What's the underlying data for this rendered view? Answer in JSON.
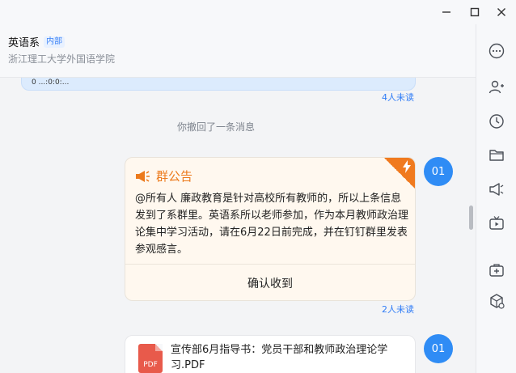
{
  "window": {
    "minimize_icon": "minimize-icon",
    "maximize_icon": "maximize-icon",
    "close_icon": "close-icon"
  },
  "header": {
    "title": "英语系",
    "tag": "内部",
    "subtitle": "浙江理工大学外国语学院"
  },
  "chat": {
    "prev_message_fragment": "0 ...:0:0:...",
    "prev_unread": "4人未读",
    "recall_notice": "你撤回了一条消息",
    "announcement": {
      "avatar_text": "01",
      "title": "群公告",
      "body": "@所有人 廉政教育是针对高校所有教师的，所以上条信息发到了系群里。英语系所以老师参加，作为本月教师政治理论集中学习活动，请在6月22日前完成，并在钉钉群里发表参观感言。",
      "action_label": "确认收到",
      "unread": "2人未读"
    },
    "file_message": {
      "avatar_text": "01",
      "file_type": "PDF",
      "file_name": "宣传部6月指导书：党员干部和教师政治理论学习.PDF"
    }
  },
  "sidebar": {
    "icons": [
      "more-icon",
      "add-member-icon",
      "history-icon",
      "folder-icon",
      "announcement-icon",
      "live-icon",
      "add-app-icon",
      "app-box-icon"
    ]
  },
  "colors": {
    "accent_blue": "#2f8cf5",
    "announcement_orange": "#ec7a1c",
    "pdf_red": "#e85a4b"
  }
}
